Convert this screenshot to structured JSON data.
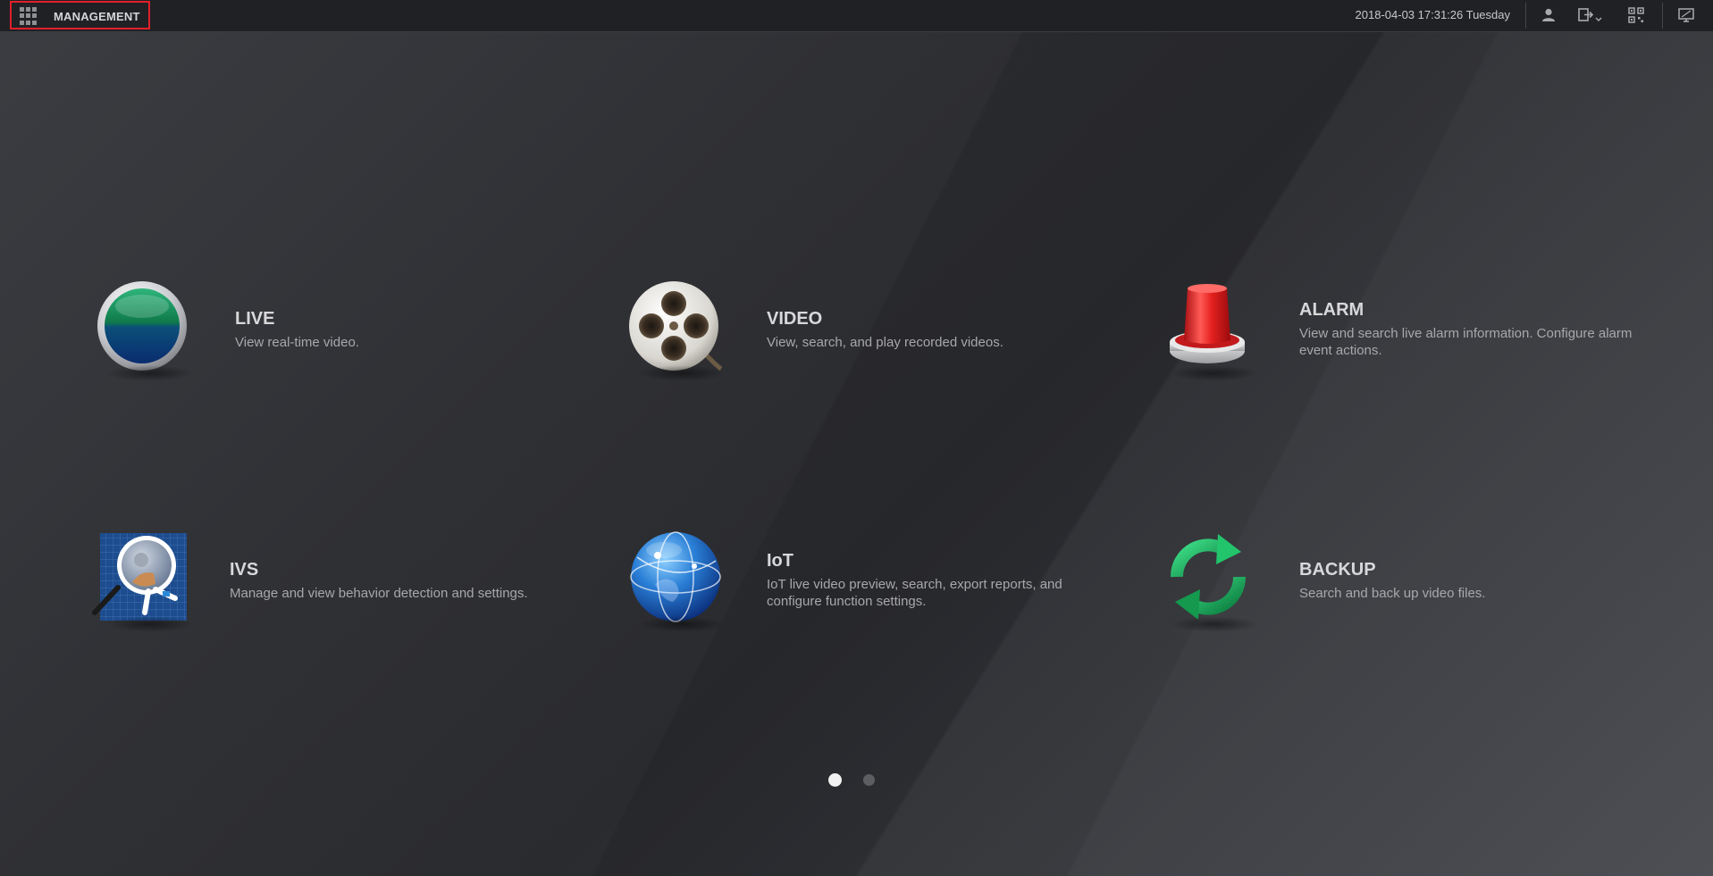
{
  "topbar": {
    "menu_label": "MANAGEMENT",
    "datetime": "2018-04-03 17:31:26 Tuesday",
    "icons": [
      "user-icon",
      "logout-icon",
      "qrcode-icon",
      "monitor-icon"
    ]
  },
  "tiles": [
    {
      "title": "LIVE",
      "desc": "View real-time video.",
      "icon": "live-icon"
    },
    {
      "title": "VIDEO",
      "desc": "View, search, and play recorded videos.",
      "icon": "film-reel-icon"
    },
    {
      "title": "ALARM",
      "desc": "View and search live alarm information. Configure alarm event actions.",
      "icon": "alarm-light-icon"
    },
    {
      "title": "IVS",
      "desc": "Manage and view behavior detection and settings.",
      "icon": "magnifier-icon"
    },
    {
      "title": "IoT",
      "desc": "IoT live video preview, search, export reports, and configure function settings.",
      "icon": "globe-icon"
    },
    {
      "title": "BACKUP",
      "desc": "Search and back up video files.",
      "icon": "refresh-icon"
    }
  ],
  "pager": {
    "pages": 2,
    "current": 1
  },
  "colors": {
    "highlight_border": "#e0202a",
    "topbar_bg": "#202124"
  }
}
